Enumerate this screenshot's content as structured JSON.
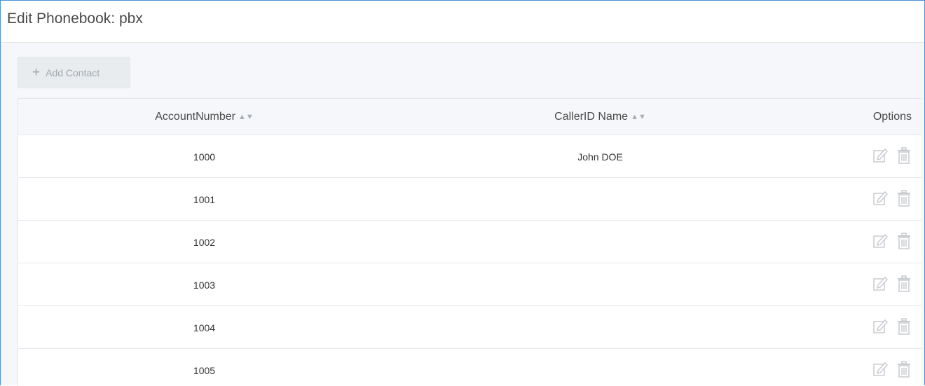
{
  "title": "Edit Phonebook: pbx",
  "toolbar": {
    "add_label": "Add Contact",
    "add_icon": "plus-icon"
  },
  "table": {
    "columns": [
      {
        "label": "AccountNumber",
        "sortable": true
      },
      {
        "label": "CallerID Name",
        "sortable": true
      },
      {
        "label": "Options",
        "sortable": false
      }
    ],
    "rows": [
      {
        "account": "1000",
        "caller_id": "John DOE"
      },
      {
        "account": "1001",
        "caller_id": ""
      },
      {
        "account": "1002",
        "caller_id": ""
      },
      {
        "account": "1003",
        "caller_id": ""
      },
      {
        "account": "1004",
        "caller_id": ""
      },
      {
        "account": "1005",
        "caller_id": ""
      }
    ],
    "row_actions": [
      "edit-icon",
      "trash-icon"
    ]
  },
  "colors": {
    "frame_border": "#4a90d9",
    "icon_muted": "#c8ccd1",
    "header_bg": "#f5f7fa"
  }
}
